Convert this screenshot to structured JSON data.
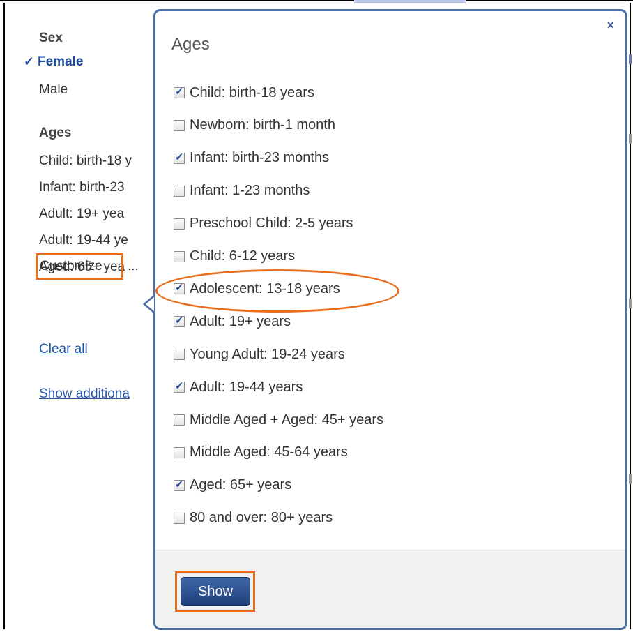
{
  "sidebar": {
    "sex_heading": "Sex",
    "sex_selected": "Female",
    "sex_other": "Male",
    "ages_heading": "Ages",
    "age_items": [
      "Child: birth-18 y",
      "Infant: birth-23",
      "Adult: 19+ yea",
      "Adult: 19-44 ye",
      "Aged: 65+ yea"
    ],
    "customize_label": "Customize",
    "customize_dots": "...",
    "clear_all": "Clear all",
    "show_additional": "Show additiona"
  },
  "popover": {
    "title": "Ages",
    "close_label": "×",
    "options": [
      {
        "label": "Child: birth-18 years",
        "checked": true
      },
      {
        "label": "Newborn: birth-1 month",
        "checked": false
      },
      {
        "label": "Infant: birth-23 months",
        "checked": true
      },
      {
        "label": "Infant: 1-23 months",
        "checked": false
      },
      {
        "label": "Preschool Child: 2-5 years",
        "checked": false
      },
      {
        "label": "Child: 6-12 years",
        "checked": false
      },
      {
        "label": "Adolescent: 13-18 years",
        "checked": true
      },
      {
        "label": "Adult: 19+ years",
        "checked": true
      },
      {
        "label": "Young Adult: 19-24 years",
        "checked": false
      },
      {
        "label": "Adult: 19-44 years",
        "checked": true
      },
      {
        "label": "Middle Aged + Aged: 45+ years",
        "checked": false
      },
      {
        "label": "Middle Aged: 45-64 years",
        "checked": false
      },
      {
        "label": "Aged: 65+ years",
        "checked": true
      },
      {
        "label": "80 and over: 80+ years",
        "checked": false
      }
    ],
    "show_button": "Show"
  },
  "colors": {
    "accent": "#e86f1f",
    "popover_border": "#4a6fa5",
    "link": "#2255aa",
    "button": "#2a4f8f"
  }
}
